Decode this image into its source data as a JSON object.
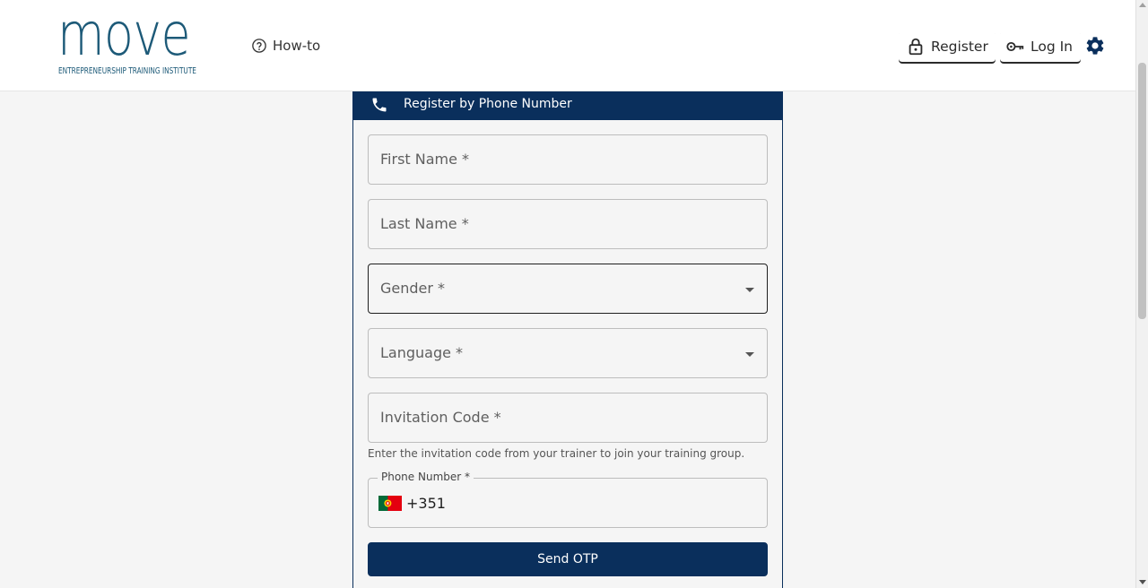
{
  "header": {
    "logo_word": "move",
    "logo_tagline": "ENTREPRENEURSHIP  TRAINING  INSTITUTE",
    "howto_label": "How-to",
    "register_label": "Register",
    "login_label": "Log In"
  },
  "form": {
    "title": "Register by Phone Number",
    "first_name_label": "First Name *",
    "last_name_label": "Last Name *",
    "gender_label": "Gender *",
    "language_label": "Language *",
    "invitation_label": "Invitation Code *",
    "invitation_helper": "Enter the invitation code from your trainer to join your training group.",
    "phone_label": "Phone Number *",
    "phone_code": "+351",
    "send_label": "Send OTP"
  },
  "colors": {
    "primary": "#0a2f5c",
    "logo": "#1d5a78",
    "background": "#f5f5f5"
  },
  "icons": {
    "howto": "help-circle-icon",
    "register": "lock-open-icon",
    "login": "key-icon",
    "settings": "gear-icon",
    "phone": "phone-icon",
    "flag": "portugal-flag-icon"
  }
}
